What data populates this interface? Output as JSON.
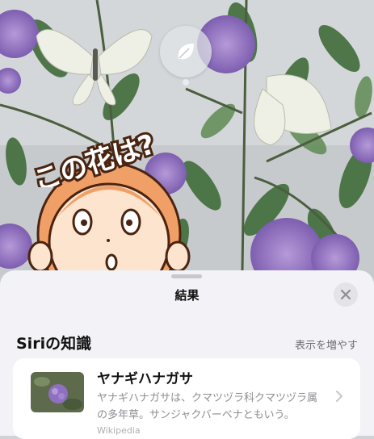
{
  "photo": {
    "description_icon": "leaf-icon",
    "sticker_text": "この花は?"
  },
  "sheet": {
    "title": "結果",
    "close_icon": "close-icon",
    "section_title": "Siriの知識",
    "more_label": "表示を増やす",
    "result": {
      "title": "ヤナギハナガサ",
      "description_line1": "ヤナギハナガサは、クマツヅラ科クマツヅラ属",
      "description_line2": "の多年草。サンジャクバーベナともいう。",
      "source": "Wikipedia"
    }
  },
  "colors": {
    "sheet_bg": "#f2f2f7",
    "card_bg": "#ffffff",
    "secondary_text": "#8e8e93",
    "flower_purple": "#8e6fc0",
    "sticker_brown": "#4a2410"
  }
}
